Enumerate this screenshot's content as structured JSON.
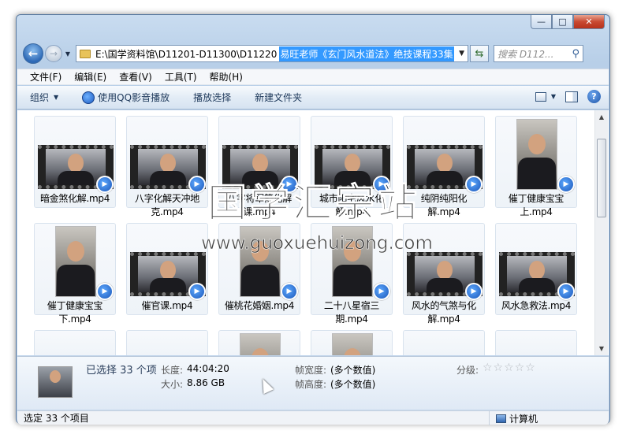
{
  "window": {
    "minimize_glyph": "—",
    "maximize_glyph": "□",
    "close_glyph": "✕"
  },
  "address": {
    "path_plain": "E:\\国学资料馆\\D11201-D11300\\D11220",
    "path_selected": "易旺老师《玄门风水道法》绝技课程33集",
    "search_placeholder": "搜索 D112..."
  },
  "menu": [
    "文件(F)",
    "编辑(E)",
    "查看(V)",
    "工具(T)",
    "帮助(H)"
  ],
  "toolbar": {
    "organize": "组织",
    "play_qq": "使用QQ影音播放",
    "play_selection": "播放选择",
    "new_folder": "新建文件夹",
    "help": "?"
  },
  "files": [
    {
      "name": "暗金煞化解.mp4",
      "thumb": "film"
    },
    {
      "name": "八字化解天冲地克.mp4",
      "thumb": "film"
    },
    {
      "name": "八字将军箭化解课.mp4",
      "thumb": "film"
    },
    {
      "name": "城市阳宅风水化解.mp4",
      "thumb": "film"
    },
    {
      "name": "纯阴纯阳化解.mp4",
      "thumb": "film"
    },
    {
      "name": "催丁健康宝宝上.mp4",
      "thumb": "portrait"
    },
    {
      "name": "催丁健康宝宝下.mp4",
      "thumb": "portrait"
    },
    {
      "name": "催官课.mp4",
      "thumb": "film"
    },
    {
      "name": "催桃花婚姻.mp4",
      "thumb": "portrait"
    },
    {
      "name": "二十八星宿三期.mp4",
      "thumb": "portrait"
    },
    {
      "name": "风水的气煞与化解.mp4",
      "thumb": "film"
    },
    {
      "name": "风水急救法.mp4",
      "thumb": "film"
    }
  ],
  "watermark": {
    "text": "国学汇宗站",
    "url": "www.guoxuehuizong.com"
  },
  "details": {
    "selected": "已选择 33 个项",
    "duration_label": "长度:",
    "duration_value": "44:04:20",
    "size_label": "大小:",
    "size_value": "8.86 GB",
    "frame_width_label": "帧宽度:",
    "frame_width_value": "(多个数值)",
    "frame_height_label": "帧高度:",
    "frame_height_value": "(多个数值)",
    "rating_label": "分级:",
    "rating_stars": "☆☆☆☆☆"
  },
  "status": {
    "left": "选定 33 个项目",
    "right": "计算机"
  }
}
